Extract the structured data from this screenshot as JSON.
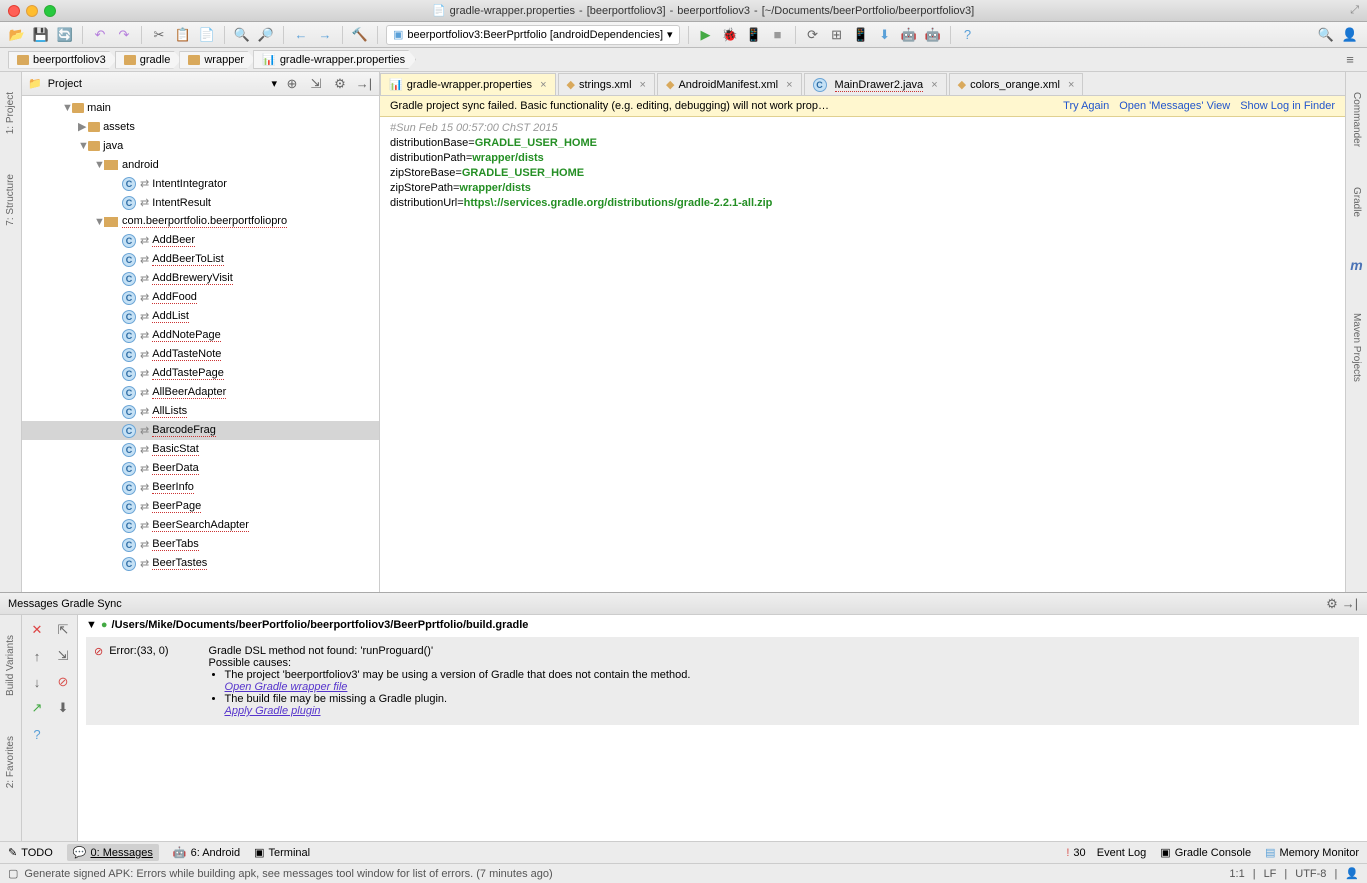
{
  "window": {
    "title_filename": "gradle-wrapper.properties",
    "title_module": "[beerportfoliov3]",
    "title_project": "beerportfoliov3",
    "title_path": "[~/Documents/beerPortfolio/beerportfoliov3]"
  },
  "toolbar": {
    "run_config": "beerportfoliov3:BeerPprtfolio [androidDependencies]"
  },
  "breadcrumbs": [
    "beerportfoliov3",
    "gradle",
    "wrapper",
    "gradle-wrapper.properties"
  ],
  "projectPanel": {
    "title": "Project",
    "tree": {
      "main": "main",
      "assets": "assets",
      "java": "java",
      "android": "android",
      "intentIntegrator": "IntentIntegrator",
      "intentResult": "IntentResult",
      "pkg": "com.beerportfolio.beerportfoliopro",
      "classes": [
        "AddBeer",
        "AddBeerToList",
        "AddBreweryVisit",
        "AddFood",
        "AddList",
        "AddNotePage",
        "AddTasteNote",
        "AddTastePage",
        "AllBeerAdapter",
        "AllLists",
        "BarcodeFrag",
        "BasicStat",
        "BeerData",
        "BeerInfo",
        "BeerPage",
        "BeerSearchAdapter",
        "BeerTabs",
        "BeerTastes"
      ]
    }
  },
  "editorTabs": [
    {
      "label": "gradle-wrapper.properties",
      "active": true,
      "icon": "props"
    },
    {
      "label": "strings.xml",
      "icon": "xml"
    },
    {
      "label": "AndroidManifest.xml",
      "icon": "xml"
    },
    {
      "label": "MainDrawer2.java",
      "icon": "class",
      "underline": true
    },
    {
      "label": "colors_orange.xml",
      "icon": "xml"
    }
  ],
  "warning": {
    "text": "Gradle project sync failed. Basic functionality (e.g. editing, debugging) will not work prop…",
    "tryAgain": "Try Again",
    "openMsgs": "Open 'Messages' View",
    "showLog": "Show Log in Finder"
  },
  "editor": {
    "comment": "#Sun Feb 15 00:57:00 ChST 2015",
    "l1k": "distributionBase=",
    "l1v": "GRADLE_USER_HOME",
    "l2k": "distributionPath=",
    "l2v": "wrapper/dists",
    "l3k": "zipStoreBase=",
    "l3v": "GRADLE_USER_HOME",
    "l4k": "zipStorePath=",
    "l4v": "wrapper/dists",
    "l5k": "distributionUrl=",
    "l5v": "https\\://services.gradle.org/distributions/gradle-2.2.1-all.zip"
  },
  "messages": {
    "title": "Messages Gradle Sync",
    "path": "/Users/Mike/Documents/beerPortfolio/beerportfoliov3/BeerPprtfolio/build.gradle",
    "line1": "Gradle DSL method not found: 'runProguard()'",
    "line2": "Possible causes:",
    "errLabel": "Error:(33, 0)",
    "cause1": "The project 'beerportfoliov3' may be using a version of Gradle that does not contain the method.",
    "link1": "Open Gradle wrapper file",
    "cause2": "The build file may be missing a Gradle plugin.",
    "link2": "Apply Gradle plugin"
  },
  "bottomTabs": {
    "todo": "TODO",
    "messages": "0: Messages",
    "android": "6: Android",
    "terminal": "Terminal",
    "eventLogCount": "30",
    "eventLog": "Event Log",
    "gradleConsole": "Gradle Console",
    "memMonitor": "Memory Monitor"
  },
  "statusbar": {
    "text": "Generate signed APK: Errors while building apk, see messages tool window for list of errors. (7 minutes ago)",
    "pos": "1:1",
    "lf": "LF",
    "enc": "UTF-8"
  },
  "leftGutter": {
    "project": "1: Project",
    "structure": "7: Structure",
    "buildVariants": "Build Variants",
    "favorites": "2: Favorites"
  },
  "rightGutter": {
    "commander": "Commander",
    "gradle": "Gradle",
    "maven": "Maven Projects",
    "m": "m"
  }
}
